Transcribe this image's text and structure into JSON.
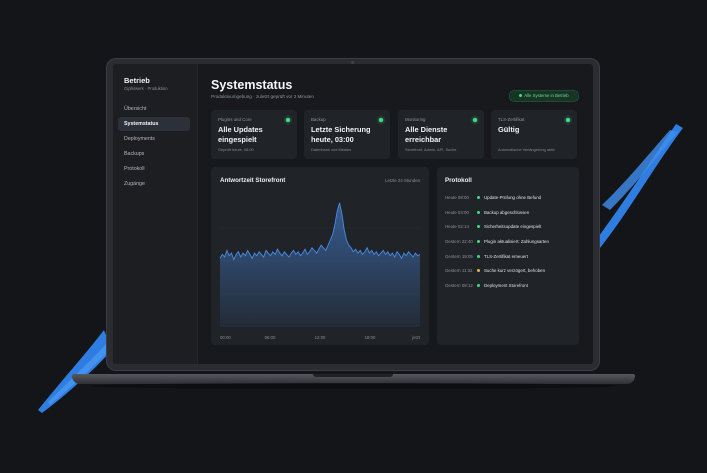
{
  "app": {
    "title": "Betrieb",
    "subtitle": "Gipfelwerk · Produktion"
  },
  "nav": [
    {
      "label": "Übersicht",
      "active": false
    },
    {
      "label": "Systemstatus",
      "active": true
    },
    {
      "label": "Deployments",
      "active": false
    },
    {
      "label": "Backups",
      "active": false
    },
    {
      "label": "Protokoll",
      "active": false
    },
    {
      "label": "Zugänge",
      "active": false
    }
  ],
  "header": {
    "title": "Systemstatus",
    "subtitle": "Produktivumgebung · zuletzt geprüft vor 2 Minuten",
    "status_badge": "Alle Systeme in Betrieb"
  },
  "cards": [
    {
      "label": "Plugins und Core",
      "value": "Alle Updates eingespielt",
      "note": "Geprüft heute, 08:00",
      "status_color": "#3ddc84"
    },
    {
      "label": "Backup",
      "value": "Letzte Sicherung heute, 03:00",
      "note": "Datenbank und Medien",
      "status_color": "#3ddc84"
    },
    {
      "label": "Monitoring",
      "value": "Alle Dienste erreichbar",
      "note": "Storefront, Admin, API, Suche",
      "status_color": "#3ddc84"
    },
    {
      "label": "TLS-Zertifikat",
      "value": "Gültig",
      "note": "Automatische Verlängerung aktiv",
      "status_color": "#3ddc84"
    }
  ],
  "chart_panel": {
    "title": "Antwortzeit Storefront",
    "range": "Letzte 24 Stunden"
  },
  "chart_data": {
    "type": "area",
    "title": "Antwortzeit Storefront",
    "x_ticks": [
      "00:00",
      "06:00",
      "12:00",
      "18:00",
      "jetzt"
    ],
    "values": [
      0.52,
      0.55,
      0.53,
      0.58,
      0.54,
      0.56,
      0.51,
      0.55,
      0.57,
      0.53,
      0.56,
      0.54,
      0.58,
      0.55,
      0.52,
      0.56,
      0.54,
      0.57,
      0.55,
      0.53,
      0.58,
      0.56,
      0.54,
      0.57,
      0.55,
      0.59,
      0.56,
      0.54,
      0.57,
      0.55,
      0.53,
      0.56,
      0.58,
      0.55,
      0.57,
      0.54,
      0.56,
      0.59,
      0.55,
      0.57,
      0.6,
      0.58,
      0.56,
      0.59,
      0.62,
      0.6,
      0.58,
      0.62,
      0.66,
      0.7,
      0.78,
      0.88,
      0.94,
      0.86,
      0.74,
      0.66,
      0.62,
      0.6,
      0.57,
      0.59,
      0.56,
      0.58,
      0.55,
      0.57,
      0.6,
      0.56,
      0.58,
      0.55,
      0.57,
      0.54,
      0.56,
      0.58,
      0.55,
      0.57,
      0.54,
      0.56,
      0.53,
      0.57,
      0.55,
      0.52,
      0.56,
      0.54,
      0.57,
      0.55,
      0.53,
      0.56,
      0.54,
      0.55
    ],
    "color": "#4a8be8",
    "grid": true
  },
  "log": {
    "title": "Protokoll",
    "entries": [
      {
        "time": "Heute 08:00",
        "text": "Update-Prüfung ohne Befund",
        "color": "#3ddc84"
      },
      {
        "time": "Heute 03:00",
        "text": "Backup abgeschlossen",
        "color": "#3ddc84"
      },
      {
        "time": "Heute 02:14",
        "text": "Sicherheitsupdate eingespielt",
        "color": "#3ddc84"
      },
      {
        "time": "Gestern 22:40",
        "text": "Plugin aktualisiert: Zahlungsarten",
        "color": "#3ddc84"
      },
      {
        "time": "Gestern 19:05",
        "text": "TLS-Zertifikat erneuert",
        "color": "#3ddc84"
      },
      {
        "time": "Gestern 11:32",
        "text": "Suche kurz verzögert, behoben",
        "color": "#e0b84a"
      },
      {
        "time": "Gestern 09:12",
        "text": "Deployment Storefront",
        "color": "#3ddc84"
      }
    ]
  },
  "colors": {
    "accent": "#4a8be8",
    "success": "#3ddc84",
    "warning": "#e0b84a",
    "stroke": "#2f7de1"
  }
}
